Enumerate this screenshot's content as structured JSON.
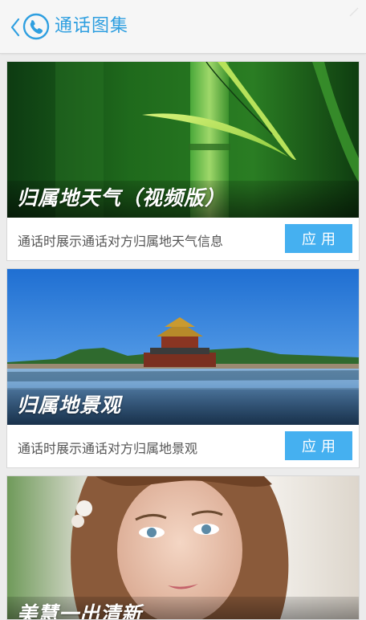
{
  "header": {
    "title": "通话图集"
  },
  "cards": [
    {
      "caption": "归属地天气（视频版）",
      "description": "通话时展示通话对方归属地天气信息",
      "apply_label": "应用"
    },
    {
      "caption": "归属地景观",
      "description": "通话时展示通话对方归属地景观",
      "apply_label": "应用"
    },
    {
      "caption": "美慧一出清新"
    }
  ],
  "colors": {
    "accent": "#2f9fe0",
    "button": "#45b0f0",
    "description_text": "#555555",
    "background": "#ececec"
  },
  "icons": {
    "back": "chevron-left-icon",
    "app": "phone-icon"
  }
}
